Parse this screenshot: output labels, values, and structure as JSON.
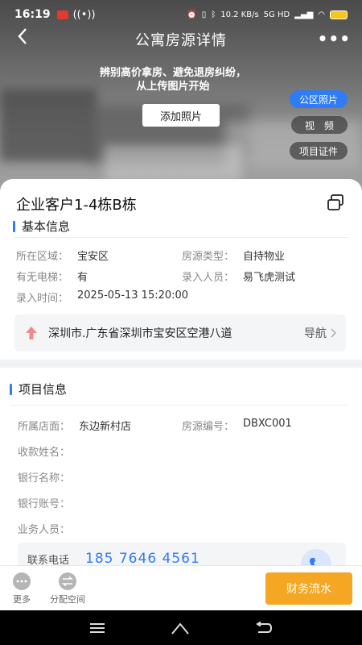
{
  "status_bar": {
    "time": "16:19",
    "speed": "10.2 KB/s",
    "network": "5G HD"
  },
  "header": {
    "title": "公寓房源详情",
    "back_icon": "chevron-left-icon",
    "more_icon": "more-dots-icon"
  },
  "hero": {
    "hint_line1": "辨别高价拿房、避免退房纠纷，",
    "hint_line2": "从上传图片开始",
    "add_photo_label": "添加照片",
    "tags": [
      {
        "label": "公区照片",
        "active": true
      },
      {
        "label": "视　频",
        "active": false
      },
      {
        "label": "项目证件",
        "active": false
      }
    ]
  },
  "property": {
    "name": "企业客户1-4栋B栋",
    "basic_section_title": "基本信息",
    "fields": {
      "area_label": "所在区域：",
      "area_value": "宝安区",
      "type_label": "房源类型：",
      "type_value": "自持物业",
      "elevator_label": "有无电梯：",
      "elevator_value": "有",
      "entry_person_label": "录入人员：",
      "entry_person_value": "易飞虎测试",
      "entry_time_label": "录入时间：",
      "entry_time_value": "2025-05-13 15:20:00"
    },
    "address": "深圳市.广东省深圳市宝安区空港八道",
    "nav_label": "导航"
  },
  "project": {
    "section_title": "项目信息",
    "store_label": "所属店面：",
    "store_value": "东边新村店",
    "code_label": "房源编号：",
    "code_value": "DBXC001",
    "payee_label": "收款姓名：",
    "bank_label": "银行名称：",
    "account_label": "银行账号：",
    "staff_label": "业务人员：",
    "contact_label": "联系电话",
    "contact_phone": "185 7646 4561"
  },
  "bottom_bar": {
    "more_label": "更多",
    "assign_label": "分配空间",
    "finance_label": "财务流水"
  },
  "colors": {
    "accent": "#2f7cf6",
    "finance": "#f5a623"
  }
}
